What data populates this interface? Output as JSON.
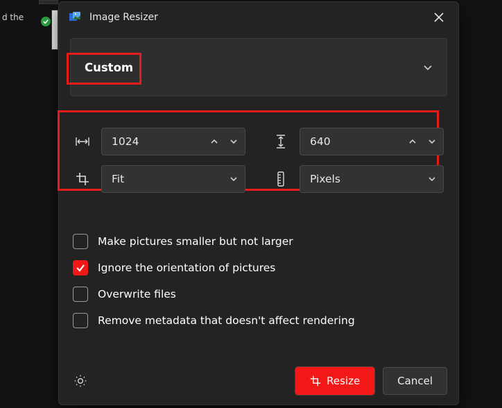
{
  "bg": {
    "context_line1": "d the"
  },
  "dialog": {
    "title": "Image Resizer",
    "preset": {
      "label": "Custom"
    },
    "width": {
      "value": "1024"
    },
    "height": {
      "value": "640"
    },
    "fit": {
      "label": "Fit"
    },
    "unit": {
      "label": "Pixels"
    },
    "options": {
      "smaller_only": {
        "label": "Make pictures smaller but not larger",
        "checked": false
      },
      "ignore_orient": {
        "label": "Ignore the orientation of pictures",
        "checked": true
      },
      "overwrite": {
        "label": "Overwrite files",
        "checked": false
      },
      "remove_meta": {
        "label": "Remove metadata that doesn't affect rendering",
        "checked": false
      }
    },
    "buttons": {
      "resize": "Resize",
      "cancel": "Cancel"
    }
  }
}
